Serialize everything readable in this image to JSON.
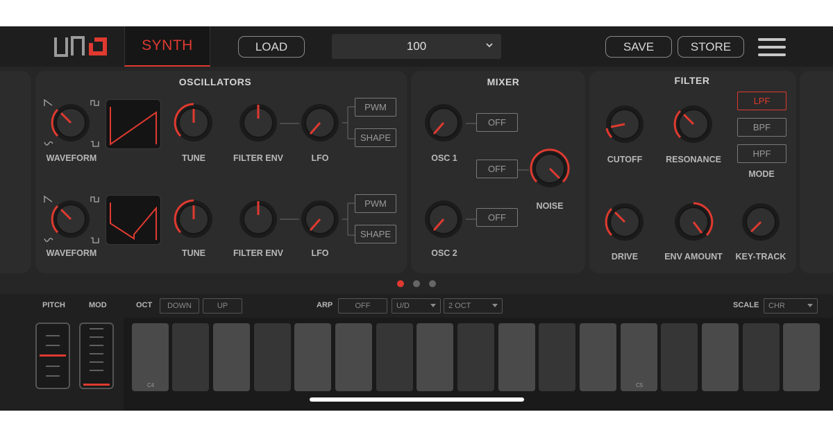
{
  "header": {
    "tab_label": "SYNTH",
    "load_label": "LOAD",
    "preset_value": "100",
    "save_label": "SAVE",
    "store_label": "STORE"
  },
  "oscillators": {
    "title": "OSCILLATORS",
    "row1": {
      "waveform": "WAVEFORM",
      "tune": "TUNE",
      "filter_env": "FILTER ENV",
      "lfo": "LFO",
      "pwm": "PWM",
      "shape": "SHAPE"
    },
    "row2": {
      "waveform": "WAVEFORM",
      "tune": "TUNE",
      "filter_env": "FILTER ENV",
      "lfo": "LFO",
      "pwm": "PWM",
      "shape": "SHAPE"
    }
  },
  "mixer": {
    "title": "MIXER",
    "osc1": "OSC 1",
    "osc2": "OSC 2",
    "noise": "NOISE",
    "osc1_toggle": "OFF",
    "noise_toggle": "OFF",
    "osc2_toggle": "OFF"
  },
  "filter": {
    "title": "FILTER",
    "cutoff": "CUTOFF",
    "resonance": "RESONANCE",
    "drive": "DRIVE",
    "env_amount": "ENV AMOUNT",
    "key_track": "KEY-TRACK",
    "mode_label": "MODE",
    "modes": [
      "LPF",
      "BPF",
      "HPF"
    ],
    "selected_mode": "LPF"
  },
  "pager": {
    "pages": 3,
    "current": 1
  },
  "keyboard": {
    "pitch_label": "PITCH",
    "mod_label": "MOD",
    "oct_label": "OCT",
    "oct_down": "DOWN",
    "oct_up": "UP",
    "arp_label": "ARP",
    "arp_toggle": "OFF",
    "arp_mode": "U/D",
    "arp_range": "2 OCT",
    "scale_label": "SCALE",
    "scale_value": "CHR",
    "note_c4": "C4",
    "note_c5": "C5"
  },
  "colors": {
    "accent": "#e03a30",
    "panel": "#2c2c2c",
    "background": "#262626"
  }
}
